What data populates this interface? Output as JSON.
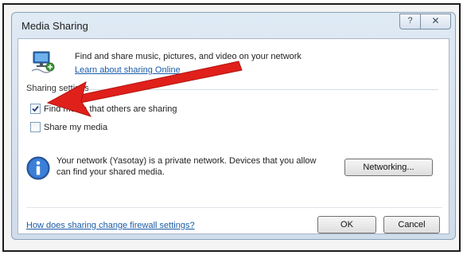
{
  "window": {
    "title": "Media Sharing",
    "help_glyph": "?",
    "close_glyph": "✕"
  },
  "intro": {
    "text": "Find and share music, pictures, and video on your network",
    "learn_link": "Learn about sharing Online",
    "icon": "media-network-icon"
  },
  "sharing_settings": {
    "label": "Sharing settings",
    "options": [
      {
        "label": "Find media that others are sharing",
        "checked": true
      },
      {
        "label": "Share my media",
        "checked": false
      }
    ]
  },
  "network": {
    "icon": "info-icon",
    "message": "Your network (Yasotay) is a private network. Devices that you allow can find your shared media.",
    "networking_button": "Networking..."
  },
  "footer": {
    "firewall_link": "How does sharing change firewall settings?",
    "ok_button": "OK",
    "cancel_button": "Cancel"
  },
  "annotation": {
    "arrow_color": "#e0201a",
    "icon": "red-arrow-annotation"
  }
}
